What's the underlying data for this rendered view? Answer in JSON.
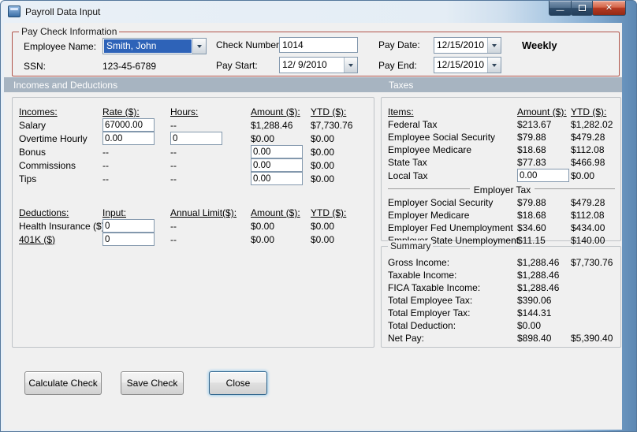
{
  "window": {
    "title": "Payroll Data Input",
    "controls": {
      "minimize": "—",
      "close": "✕"
    }
  },
  "paycheck": {
    "legend": "Pay Check Information",
    "employee_name": {
      "label": "Employee Name:",
      "value": "Smith, John"
    },
    "ssn": {
      "label": "SSN:",
      "value": "123-45-6789"
    },
    "check_number": {
      "label": "Check Number:",
      "value": "1014"
    },
    "pay_start": {
      "label": "Pay Start:",
      "value": "12/ 9/2010"
    },
    "pay_date": {
      "label": "Pay Date:",
      "value": "12/15/2010"
    },
    "pay_end": {
      "label": "Pay End:",
      "value": "12/15/2010"
    },
    "frequency": "Weekly"
  },
  "sections": {
    "incomes": "Incomes and Deductions",
    "taxes": "Taxes"
  },
  "incomes": {
    "headers": {
      "name": "Incomes:",
      "rate": "Rate ($):",
      "hours": "Hours:",
      "amount": "Amount ($):",
      "ytd": "YTD ($):"
    },
    "rows": [
      {
        "name": "Salary",
        "rate": "67000.00",
        "hours": "--",
        "amount": "$1,288.46",
        "ytd": "$7,730.76"
      },
      {
        "name": "Overtime Hourly",
        "rate": "0.00",
        "hours": "0",
        "amount": "$0.00",
        "ytd": "$0.00"
      },
      {
        "name": "Bonus",
        "rate": "--",
        "hours": "--",
        "amount": "0.00",
        "ytd": "$0.00"
      },
      {
        "name": "Commissions",
        "rate": "--",
        "hours": "--",
        "amount": "0.00",
        "ytd": "$0.00"
      },
      {
        "name": "Tips",
        "rate": "--",
        "hours": "--",
        "amount": "0.00",
        "ytd": "$0.00"
      }
    ]
  },
  "deductions": {
    "headers": {
      "name": "Deductions:",
      "input": "Input:",
      "limit": "Annual Limit($):",
      "amount": "Amount ($):",
      "ytd": "YTD ($):"
    },
    "rows": [
      {
        "name": "Health Insurance ($)",
        "input": "0",
        "limit": "--",
        "amount": "$0.00",
        "ytd": "$0.00"
      },
      {
        "name": "401K ($)",
        "input": "0",
        "limit": "--",
        "amount": "$0.00",
        "ytd": "$0.00"
      }
    ]
  },
  "taxes": {
    "headers": {
      "items": "Items:",
      "amount": "Amount ($):",
      "ytd": "YTD ($):"
    },
    "employee_rows": [
      {
        "name": "Federal Tax",
        "amount": "$213.67",
        "ytd": "$1,282.02"
      },
      {
        "name": "Employee Social Security",
        "amount": "$79.88",
        "ytd": "$479.28"
      },
      {
        "name": "Employee Medicare",
        "amount": "$18.68",
        "ytd": "$112.08"
      },
      {
        "name": "State Tax",
        "amount": "$77.83",
        "ytd": "$466.98"
      },
      {
        "name": "Local Tax",
        "amount": "0.00",
        "ytd": "$0.00"
      }
    ],
    "employer_header": "Employer Tax",
    "employer_rows": [
      {
        "name": "Employer Social Security",
        "amount": "$79.88",
        "ytd": "$479.28"
      },
      {
        "name": "Employer Medicare",
        "amount": "$18.68",
        "ytd": "$112.08"
      },
      {
        "name": "Employer Fed Unemployment",
        "amount": "$34.60",
        "ytd": "$434.00"
      },
      {
        "name": "Employer State Unemployment",
        "amount": "$11.15",
        "ytd": "$140.00"
      }
    ]
  },
  "summary": {
    "legend": "Summary",
    "rows": [
      {
        "name": "Gross Income:",
        "amount": "$1,288.46",
        "ytd": "$7,730.76"
      },
      {
        "name": "Taxable Income:",
        "amount": "$1,288.46",
        "ytd": ""
      },
      {
        "name": "FICA Taxable Income:",
        "amount": "$1,288.46",
        "ytd": ""
      },
      {
        "name": "Total Employee Tax:",
        "amount": "$390.06",
        "ytd": ""
      },
      {
        "name": "Total Employer Tax:",
        "amount": "$144.31",
        "ytd": ""
      },
      {
        "name": "Total Deduction:",
        "amount": "$0.00",
        "ytd": ""
      },
      {
        "name": "Net Pay:",
        "amount": "$898.40",
        "ytd": "$5,390.40"
      }
    ]
  },
  "buttons": {
    "calculate": "Calculate Check",
    "save": "Save Check",
    "close": "Close"
  },
  "colors": {
    "paycheck_border": "#b0544a",
    "section_bar": "#a7b4c1",
    "selection_blue": "#2e63b8",
    "client_bg": "#f0f0f0",
    "close_button_red": "#b53a22"
  }
}
